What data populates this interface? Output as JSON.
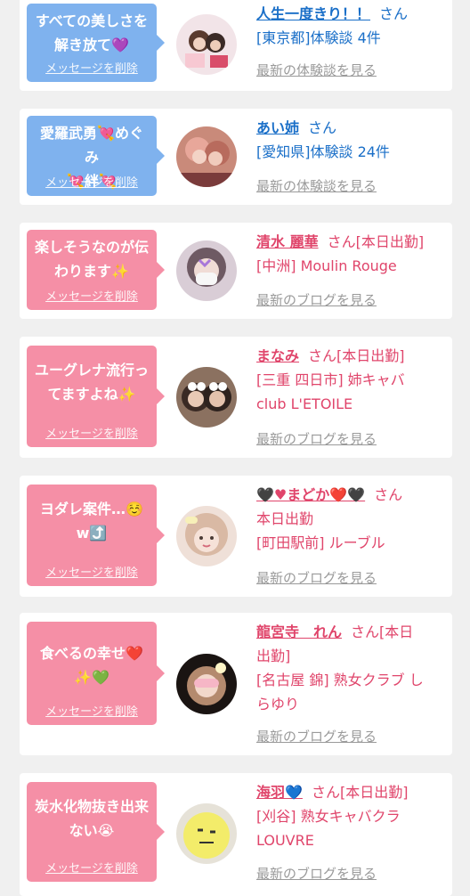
{
  "delete_label": "メッセージを削除",
  "san_label": "さん",
  "cards": [
    {
      "kind": "diary",
      "message": "すべての美しさを\n解き放て💜",
      "name": "人生一度きり！！",
      "status": "",
      "sub": "[東京都]体験談 4件",
      "latest": "最新の体験談を見る",
      "colors": {
        "bubble": "#7fb2ee",
        "text": "#1a6fc8"
      }
    },
    {
      "kind": "diary",
      "message": "愛羅武勇💘めぐみ\n💘絆💘",
      "name": "あい姉",
      "status": "",
      "sub": "[愛知県]体験談 24件",
      "latest": "最新の体験談を見る",
      "colors": {
        "bubble": "#7fb2ee",
        "text": "#1a6fc8"
      }
    },
    {
      "kind": "blog",
      "message": "楽しそうなのが伝\nわります✨",
      "name": "清水 麗華",
      "status": "[本日出勤]",
      "sub": "[中洲] Moulin Rouge",
      "latest": "最新のブログを見る",
      "colors": {
        "bubble": "#f58fa6",
        "text": "#e0456b"
      }
    },
    {
      "kind": "blog",
      "message": "ユーグレナ流行っ\nてますよね✨",
      "name": "まなみ",
      "status": "[本日出勤]",
      "sub": "[三重 四日市] 姉キャバ\nclub L'ETOILE",
      "latest": "最新のブログを見る",
      "colors": {
        "bubble": "#f58fa6",
        "text": "#e0456b"
      }
    },
    {
      "kind": "blog",
      "message": "ヨダレ案件…☺️\nw⤴️",
      "name": "🖤♥まどか❤️🖤",
      "status": "",
      "sub": "本日出勤\n[町田駅前] ルーブル",
      "latest": "最新のブログを見る",
      "colors": {
        "bubble": "#f58fa6",
        "text": "#e0456b"
      }
    },
    {
      "kind": "blog",
      "message": "食べるの幸せ❤️\n✨💚",
      "name": "龍宮寺　れん",
      "status": "[本日",
      "sub": "出勤]\n[名古屋 錦] 熟女クラブ し\nらゆり",
      "latest": "最新のブログを見る",
      "colors": {
        "bubble": "#f58fa6",
        "text": "#e0456b"
      }
    },
    {
      "kind": "blog",
      "message": "炭水化物抜き出来\nない😭",
      "name": "海羽💙",
      "status": "[本日出勤]",
      "sub": "[刈谷] 熟女キャバクラ\nLOUVRE",
      "latest": "最新のブログを見る",
      "colors": {
        "bubble": "#f58fa6",
        "text": "#e0456b"
      }
    }
  ]
}
